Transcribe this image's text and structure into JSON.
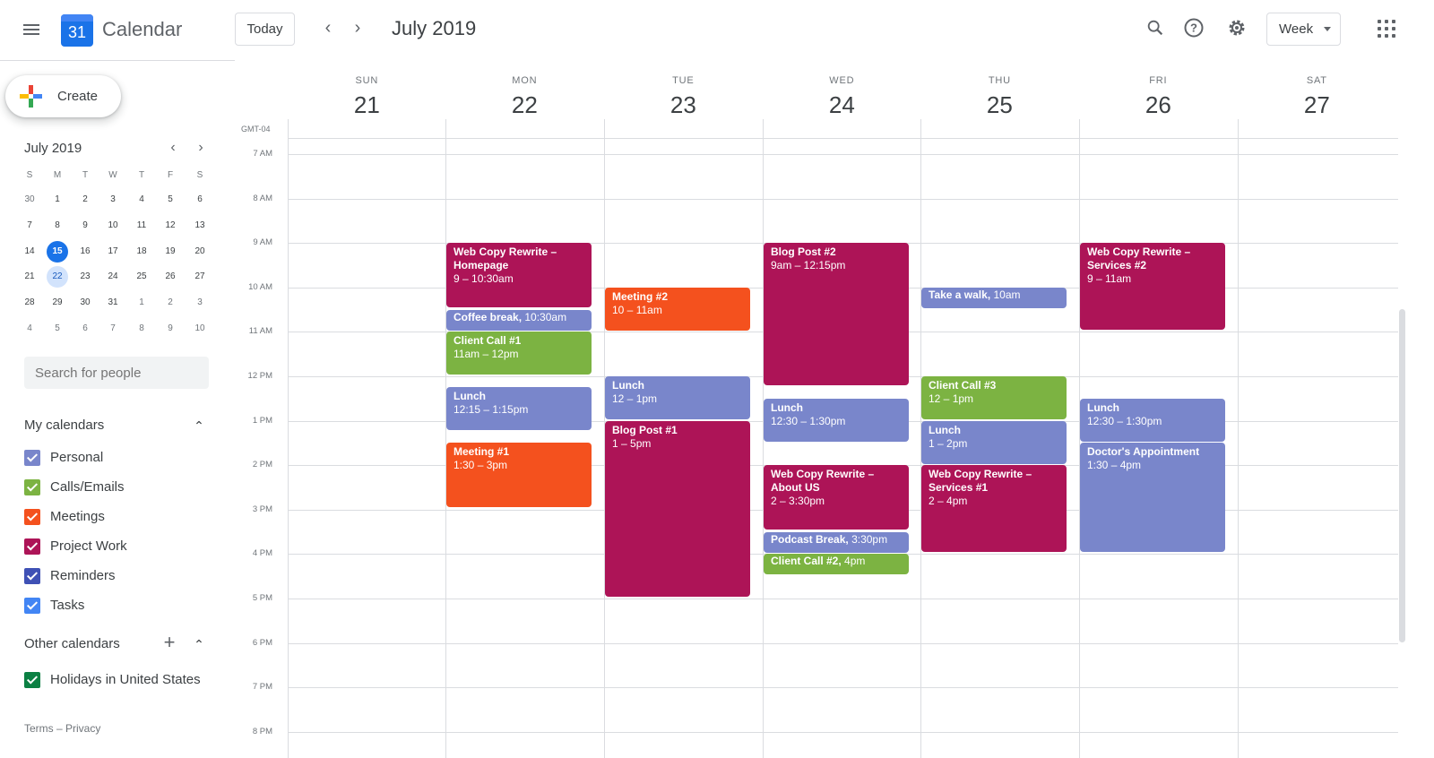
{
  "app": {
    "title": "Calendar",
    "logo_day": "31"
  },
  "header": {
    "today_label": "Today",
    "current_period": "July 2019",
    "view_selector": "Week"
  },
  "sidebar": {
    "create_label": "Create",
    "mini_calendar": {
      "title": "July 2019",
      "weekday_initials": [
        "S",
        "M",
        "T",
        "W",
        "T",
        "F",
        "S"
      ],
      "weeks": [
        [
          "30",
          "1",
          "2",
          "3",
          "4",
          "5",
          "6"
        ],
        [
          "7",
          "8",
          "9",
          "10",
          "11",
          "12",
          "13"
        ],
        [
          "14",
          "15",
          "16",
          "17",
          "18",
          "19",
          "20"
        ],
        [
          "21",
          "22",
          "23",
          "24",
          "25",
          "26",
          "27"
        ],
        [
          "28",
          "29",
          "30",
          "31",
          "1",
          "2",
          "3"
        ],
        [
          "4",
          "5",
          "6",
          "7",
          "8",
          "9",
          "10"
        ]
      ],
      "today": "15",
      "selected": "22"
    },
    "search_placeholder": "Search for people",
    "my_calendars_title": "My calendars",
    "my_calendars": [
      {
        "label": "Personal",
        "color": "#7986cb"
      },
      {
        "label": "Calls/Emails",
        "color": "#7cb342"
      },
      {
        "label": "Meetings",
        "color": "#f4511e"
      },
      {
        "label": "Project Work",
        "color": "#ad1457"
      },
      {
        "label": "Reminders",
        "color": "#3f51b5"
      },
      {
        "label": "Tasks",
        "color": "#4285f4"
      }
    ],
    "other_calendars_title": "Other calendars",
    "other_calendars": [
      {
        "label": "Holidays in United States",
        "color": "#0b8043"
      }
    ],
    "footer": "Terms – Privacy"
  },
  "week": {
    "timezone": "GMT-04",
    "days": [
      {
        "name": "SUN",
        "num": "21"
      },
      {
        "name": "MON",
        "num": "22"
      },
      {
        "name": "TUE",
        "num": "23"
      },
      {
        "name": "WED",
        "num": "24"
      },
      {
        "name": "THU",
        "num": "25"
      },
      {
        "name": "FRI",
        "num": "26"
      },
      {
        "name": "SAT",
        "num": "27"
      }
    ],
    "hours": [
      "7 AM",
      "8 AM",
      "9 AM",
      "10 AM",
      "11 AM",
      "12 PM",
      "1 PM",
      "2 PM",
      "3 PM",
      "4 PM",
      "5 PM",
      "6 PM",
      "7 PM",
      "8 PM"
    ],
    "events": [
      {
        "day": 1,
        "start": 9,
        "end": 10.5,
        "title": "Web Copy Rewrite – Homepage",
        "time": "9 – 10:30am",
        "color": "#ad1457"
      },
      {
        "day": 1,
        "start": 10.5,
        "end": 11,
        "title": "Coffee break,",
        "time": "10:30am",
        "color": "#7986cb",
        "inline": true
      },
      {
        "day": 1,
        "start": 11,
        "end": 12,
        "title": "Client Call #1",
        "time": "11am – 12pm",
        "color": "#7cb342"
      },
      {
        "day": 1,
        "start": 12.25,
        "end": 13.25,
        "title": "Lunch",
        "time": "12:15 – 1:15pm",
        "color": "#7986cb"
      },
      {
        "day": 1,
        "start": 13.5,
        "end": 15,
        "title": "Meeting #1",
        "time": "1:30 – 3pm",
        "color": "#f4511e"
      },
      {
        "day": 2,
        "start": 10,
        "end": 11,
        "title": "Meeting #2",
        "time": "10 – 11am",
        "color": "#f4511e"
      },
      {
        "day": 2,
        "start": 12,
        "end": 13,
        "title": "Lunch",
        "time": "12 – 1pm",
        "color": "#7986cb"
      },
      {
        "day": 2,
        "start": 13,
        "end": 17,
        "title": "Blog Post #1",
        "time": "1 – 5pm",
        "color": "#ad1457"
      },
      {
        "day": 3,
        "start": 9,
        "end": 12.25,
        "title": "Blog Post #2",
        "time": "9am – 12:15pm",
        "color": "#ad1457"
      },
      {
        "day": 3,
        "start": 12.5,
        "end": 13.5,
        "title": "Lunch",
        "time": "12:30 – 1:30pm",
        "color": "#7986cb"
      },
      {
        "day": 3,
        "start": 14,
        "end": 15.5,
        "title": "Web Copy Rewrite – About US",
        "time": "2 – 3:30pm",
        "color": "#ad1457"
      },
      {
        "day": 3,
        "start": 15.5,
        "end": 16,
        "title": "Podcast Break,",
        "time": "3:30pm",
        "color": "#7986cb",
        "inline": true
      },
      {
        "day": 3,
        "start": 16,
        "end": 16.5,
        "title": "Client Call #2,",
        "time": "4pm",
        "color": "#7cb342",
        "inline": true
      },
      {
        "day": 4,
        "start": 10,
        "end": 10.5,
        "title": "Take a walk,",
        "time": "10am",
        "color": "#7986cb",
        "inline": true
      },
      {
        "day": 4,
        "start": 12,
        "end": 13,
        "title": "Client Call #3",
        "time": "12 – 1pm",
        "color": "#7cb342"
      },
      {
        "day": 4,
        "start": 13,
        "end": 14,
        "title": "Lunch",
        "time": "1 – 2pm",
        "color": "#7986cb"
      },
      {
        "day": 4,
        "start": 14,
        "end": 16,
        "title": "Web Copy Rewrite – Services #1",
        "time": "2 – 4pm",
        "color": "#ad1457"
      },
      {
        "day": 5,
        "start": 9,
        "end": 11,
        "title": "Web Copy Rewrite – Services #2",
        "time": "9 – 11am",
        "color": "#ad1457"
      },
      {
        "day": 5,
        "start": 12.5,
        "end": 13.5,
        "title": "Lunch",
        "time": "12:30 – 1:30pm",
        "color": "#7986cb"
      },
      {
        "day": 5,
        "start": 13.5,
        "end": 16,
        "title": "Doctor's Appointment",
        "time": "1:30 – 4pm",
        "color": "#7986cb"
      }
    ]
  }
}
